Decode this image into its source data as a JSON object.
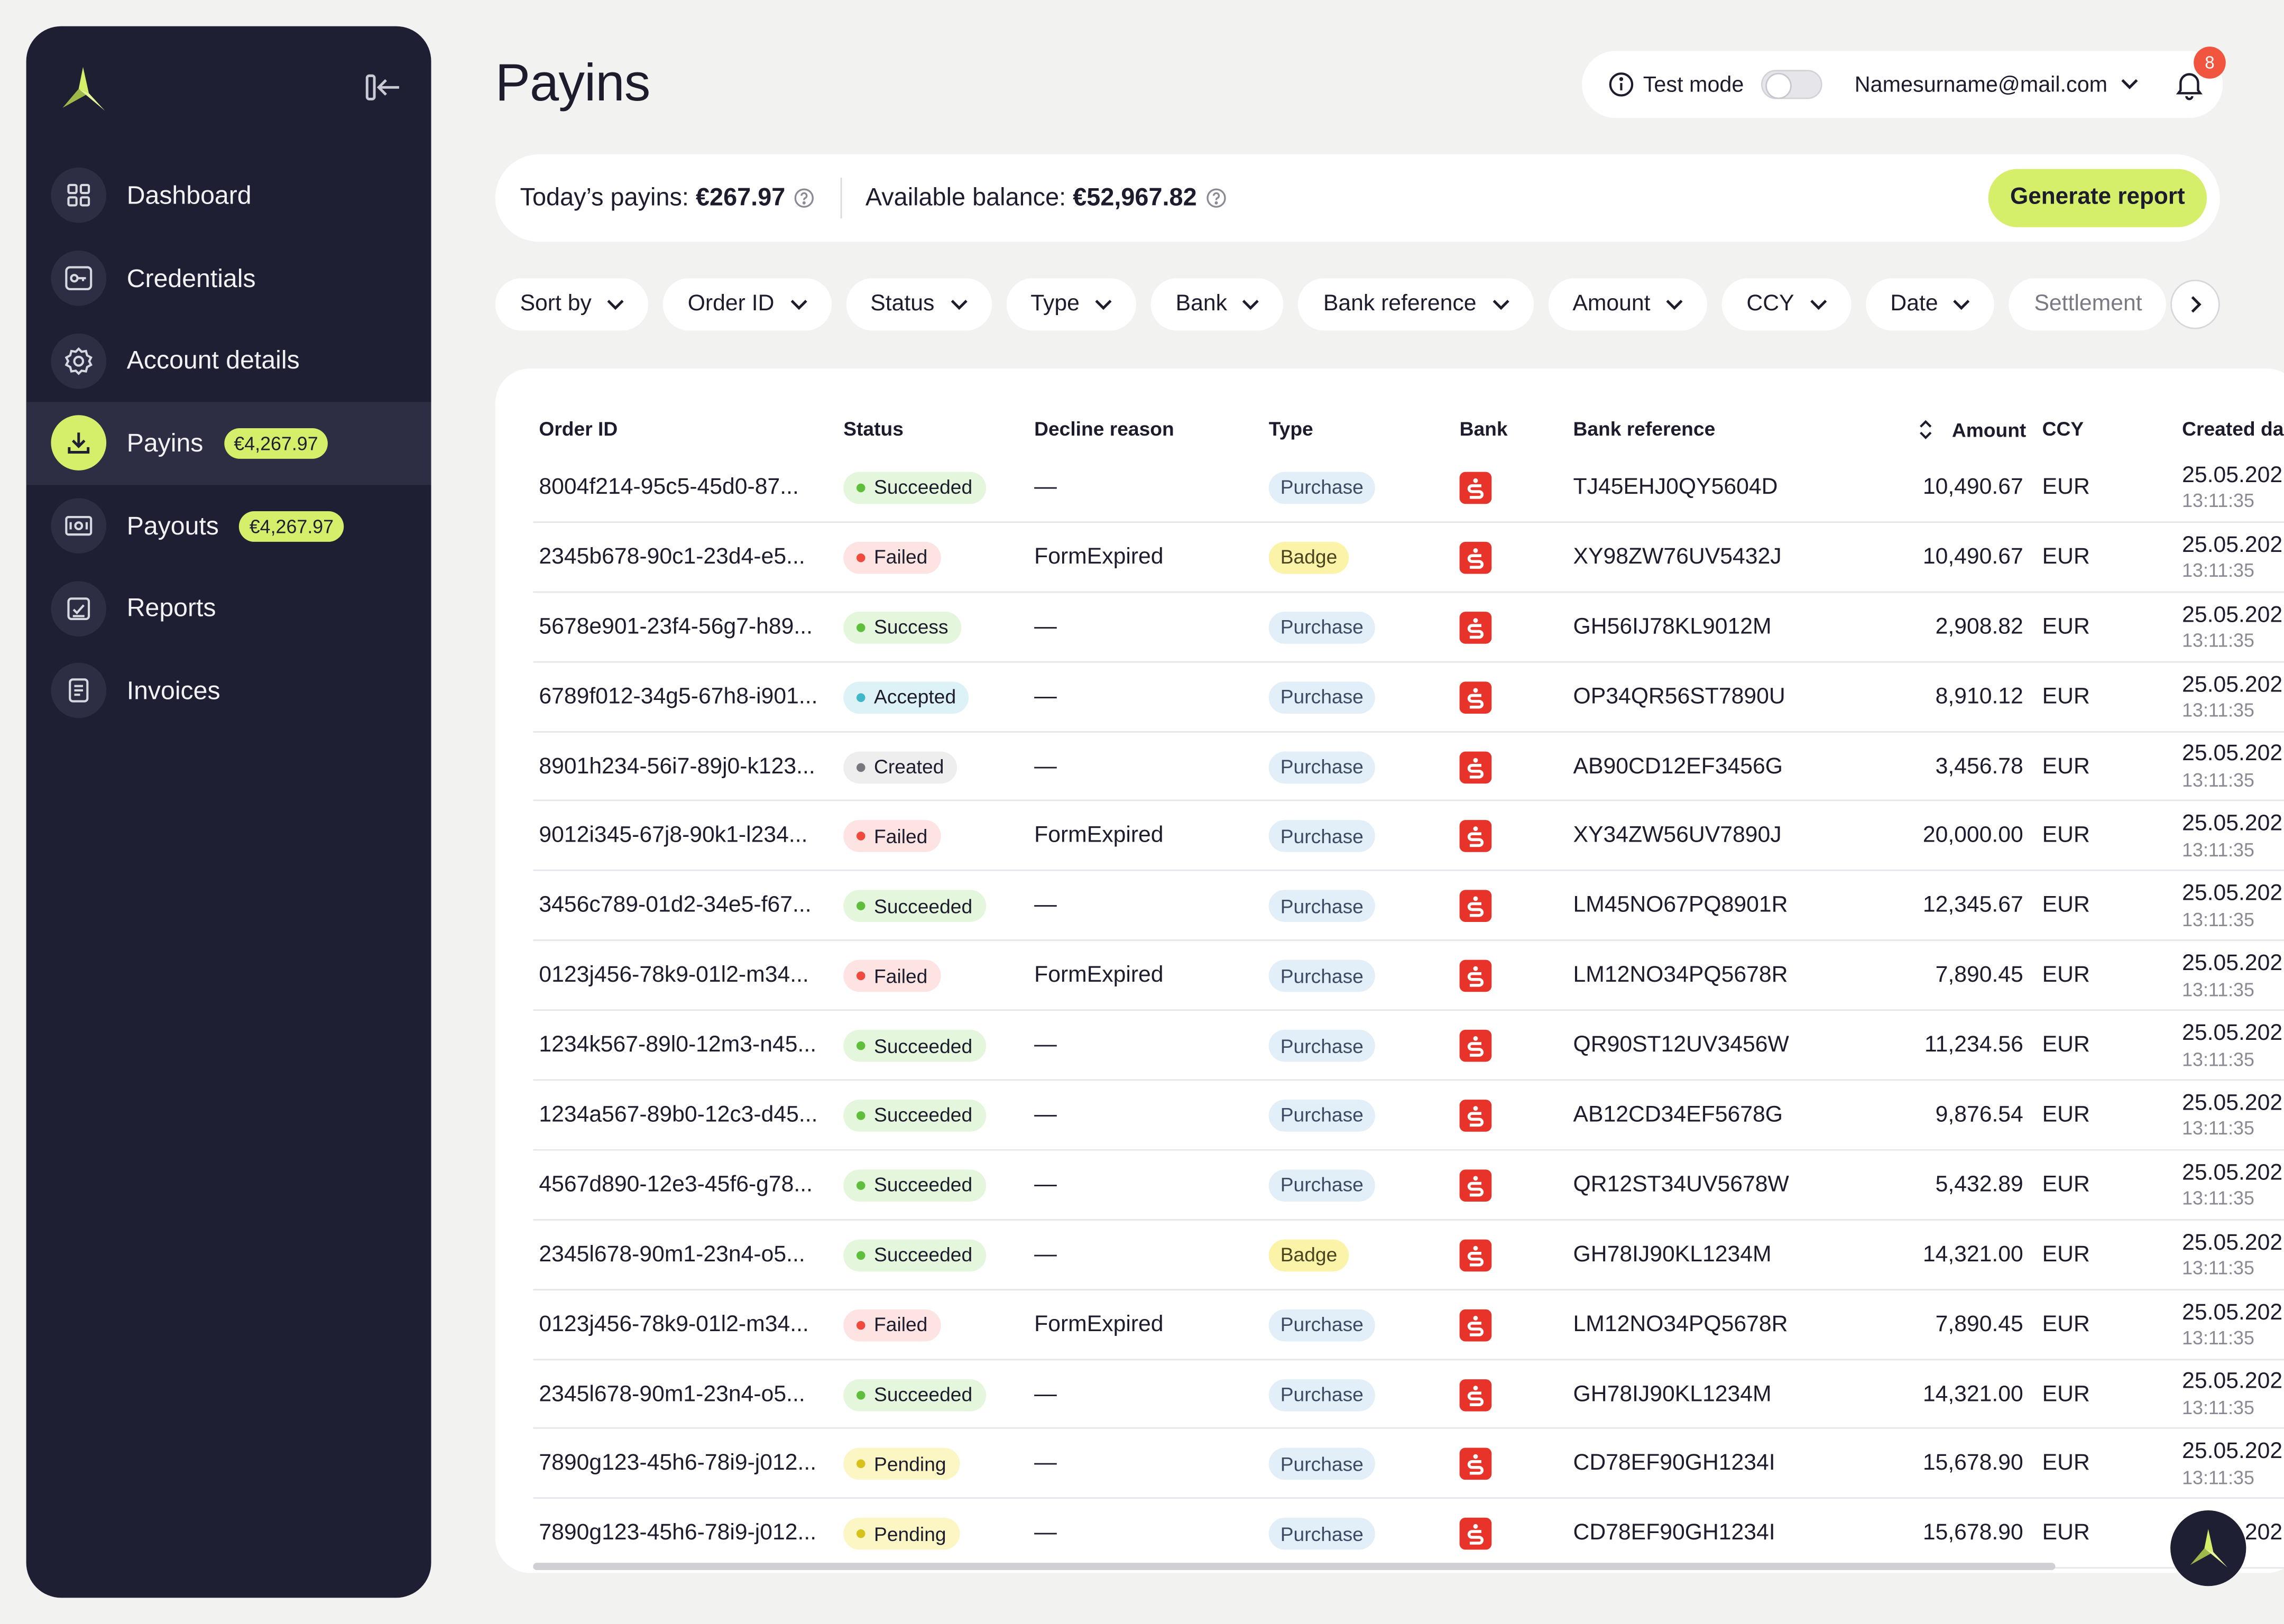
{
  "sidebar": {
    "items": [
      {
        "label": "Dashboard",
        "icon": "grid-icon",
        "active": false,
        "badge": ""
      },
      {
        "label": "Credentials",
        "icon": "key-icon",
        "active": false,
        "badge": ""
      },
      {
        "label": "Account details",
        "icon": "gear-icon",
        "active": false,
        "badge": ""
      },
      {
        "label": "Payins",
        "icon": "download-icon",
        "active": true,
        "badge": "€4,267.97"
      },
      {
        "label": "Payouts",
        "icon": "banknote-icon",
        "active": false,
        "badge": "€4,267.97"
      },
      {
        "label": "Reports",
        "icon": "report-icon",
        "active": false,
        "badge": ""
      },
      {
        "label": "Invoices",
        "icon": "invoice-icon",
        "active": false,
        "badge": ""
      }
    ]
  },
  "header": {
    "title": "Payins",
    "test_mode_label": "Test mode",
    "test_mode_on": false,
    "user_email": "Namesurname@mail.com",
    "notification_count": "8"
  },
  "summary": {
    "todays_label": "Today’s payins:",
    "todays_value": "€267.97",
    "balance_label": "Available balance:",
    "balance_value": "€52,967.82",
    "generate_label": "Generate report"
  },
  "filters": [
    "Sort by",
    "Order ID",
    "Status",
    "Type",
    "Bank",
    "Bank reference",
    "Amount",
    "CCY",
    "Date",
    "Settlement"
  ],
  "table": {
    "columns": [
      "Order ID",
      "Status",
      "Decline reason",
      "Type",
      "Bank",
      "Bank reference",
      "Amount",
      "CCY",
      "Created da"
    ],
    "rows": [
      {
        "order_id": "8004f214-95c5-45d0-87...",
        "status": "Succeeded",
        "decline": "—",
        "type": "Purchase",
        "ref": "TJ45EHJ0QY5604D",
        "amount": "10,490.67",
        "ccy": "EUR",
        "date": "25.05.202",
        "time": "13:11:35"
      },
      {
        "order_id": "2345b678-90c1-23d4-e5...",
        "status": "Failed",
        "decline": "FormExpired",
        "type": "Badge",
        "ref": "XY98ZW76UV5432J",
        "amount": "10,490.67",
        "ccy": "EUR",
        "date": "25.05.202",
        "time": "13:11:35"
      },
      {
        "order_id": "5678e901-23f4-56g7-h89...",
        "status": "Success",
        "decline": "—",
        "type": "Purchase",
        "ref": "GH56IJ78KL9012M",
        "amount": "2,908.82",
        "ccy": "EUR",
        "date": "25.05.202",
        "time": "13:11:35"
      },
      {
        "order_id": "6789f012-34g5-67h8-i901...",
        "status": "Accepted",
        "decline": "—",
        "type": "Purchase",
        "ref": "OP34QR56ST7890U",
        "amount": "8,910.12",
        "ccy": "EUR",
        "date": "25.05.202",
        "time": "13:11:35"
      },
      {
        "order_id": "8901h234-56i7-89j0-k123...",
        "status": "Created",
        "decline": "—",
        "type": "Purchase",
        "ref": "AB90CD12EF3456G",
        "amount": "3,456.78",
        "ccy": "EUR",
        "date": "25.05.202",
        "time": "13:11:35"
      },
      {
        "order_id": "9012i345-67j8-90k1-l234...",
        "status": "Failed",
        "decline": "FormExpired",
        "type": "Purchase",
        "ref": "XY34ZW56UV7890J",
        "amount": "20,000.00",
        "ccy": "EUR",
        "date": "25.05.202",
        "time": "13:11:35"
      },
      {
        "order_id": "3456c789-01d2-34e5-f67...",
        "status": "Succeeded",
        "decline": "—",
        "type": "Purchase",
        "ref": "LM45NO67PQ8901R",
        "amount": "12,345.67",
        "ccy": "EUR",
        "date": "25.05.202",
        "time": "13:11:35"
      },
      {
        "order_id": "0123j456-78k9-01l2-m34...",
        "status": "Failed",
        "decline": "FormExpired",
        "type": "Purchase",
        "ref": "LM12NO34PQ5678R",
        "amount": "7,890.45",
        "ccy": "EUR",
        "date": "25.05.202",
        "time": "13:11:35"
      },
      {
        "order_id": "1234k567-89l0-12m3-n45...",
        "status": "Succeeded",
        "decline": "—",
        "type": "Purchase",
        "ref": "QR90ST12UV3456W",
        "amount": "11,234.56",
        "ccy": "EUR",
        "date": "25.05.202",
        "time": "13:11:35"
      },
      {
        "order_id": "1234a567-89b0-12c3-d45...",
        "status": "Succeeded",
        "decline": "—",
        "type": "Purchase",
        "ref": "AB12CD34EF5678G",
        "amount": "9,876.54",
        "ccy": "EUR",
        "date": "25.05.202",
        "time": "13:11:35"
      },
      {
        "order_id": "4567d890-12e3-45f6-g78...",
        "status": "Succeeded",
        "decline": "—",
        "type": "Purchase",
        "ref": "QR12ST34UV5678W",
        "amount": "5,432.89",
        "ccy": "EUR",
        "date": "25.05.202",
        "time": "13:11:35"
      },
      {
        "order_id": "2345l678-90m1-23n4-o5...",
        "status": "Succeeded",
        "decline": "—",
        "type": "Badge",
        "ref": "GH78IJ90KL1234M",
        "amount": "14,321.00",
        "ccy": "EUR",
        "date": "25.05.202",
        "time": "13:11:35"
      },
      {
        "order_id": "0123j456-78k9-01l2-m34...",
        "status": "Failed",
        "decline": "FormExpired",
        "type": "Purchase",
        "ref": "LM12NO34PQ5678R",
        "amount": "7,890.45",
        "ccy": "EUR",
        "date": "25.05.202",
        "time": "13:11:35"
      },
      {
        "order_id": "2345l678-90m1-23n4-o5...",
        "status": "Succeeded",
        "decline": "—",
        "type": "Purchase",
        "ref": "GH78IJ90KL1234M",
        "amount": "14,321.00",
        "ccy": "EUR",
        "date": "25.05.202",
        "time": "13:11:35"
      },
      {
        "order_id": "7890g123-45h6-78i9-j012...",
        "status": "Pending",
        "decline": "—",
        "type": "Purchase",
        "ref": "CD78EF90GH1234I",
        "amount": "15,678.90",
        "ccy": "EUR",
        "date": "25.05.202",
        "time": "13:11:35"
      },
      {
        "order_id": "7890g123-45h6-78i9-j012...",
        "status": "Pending",
        "decline": "—",
        "type": "Purchase",
        "ref": "CD78EF90GH1234I",
        "amount": "15,678.90",
        "ccy": "EUR",
        "date": "25.05.202",
        "time": ""
      }
    ]
  },
  "colors": {
    "sidebar_bg": "#1e1f33",
    "accent": "#d6ef6a",
    "bank_red": "#e8332a",
    "status": {
      "Succeeded": {
        "bg": "#e4f6dc",
        "dot": "#5fbf3c"
      },
      "Success": {
        "bg": "#e4f6dc",
        "dot": "#5fbf3c"
      },
      "Failed": {
        "bg": "#fde3e1",
        "dot": "#ef4a3d"
      },
      "Accepted": {
        "bg": "#dcf2f6",
        "dot": "#3fb7c9"
      },
      "Created": {
        "bg": "#eeeeef",
        "dot": "#77777f"
      },
      "Pending": {
        "bg": "#fbf6c4",
        "dot": "#d6c21a"
      }
    },
    "types": {
      "Purchase": {
        "bg": "#e2eef8",
        "fg": "#3d4a63"
      },
      "Badge": {
        "bg": "#fbf3a8",
        "fg": "#4a4420"
      }
    }
  }
}
